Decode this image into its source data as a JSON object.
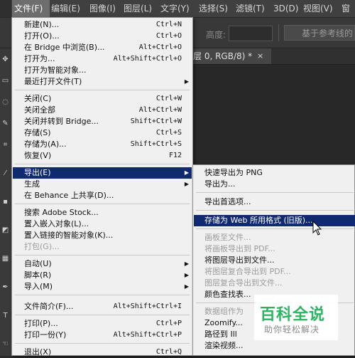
{
  "menubar": [
    "文件(F)",
    "编辑(E)",
    "图像(I)",
    "图层(L)",
    "文字(Y)",
    "选择(S)",
    "滤镜(T)",
    "3D(D)",
    "视图(V)",
    "窗"
  ],
  "options_bar": {
    "height_label": "高度:",
    "align_button": "基于参考线的"
  },
  "document_tab": {
    "title": "层 0, RGB/8) *",
    "close": "×"
  },
  "file_menu": [
    {
      "label": "新建(N)...",
      "shortcut": "Ctrl+N"
    },
    {
      "label": "打开(O)...",
      "shortcut": "Ctrl+O"
    },
    {
      "label": "在 Bridge 中浏览(B)...",
      "shortcut": "Alt+Ctrl+O"
    },
    {
      "label": "打开为...",
      "shortcut": "Alt+Shift+Ctrl+O"
    },
    {
      "label": "打开为智能对象...",
      "shortcut": ""
    },
    {
      "label": "最近打开文件(T)",
      "shortcut": ""
    },
    {
      "label": "关闭(C)",
      "shortcut": "Ctrl+W"
    },
    {
      "label": "关闭全部",
      "shortcut": "Alt+Ctrl+W"
    },
    {
      "label": "关闭并转到 Bridge...",
      "shortcut": "Shift+Ctrl+W"
    },
    {
      "label": "存储(S)",
      "shortcut": "Ctrl+S"
    },
    {
      "label": "存储为(A)...",
      "shortcut": "Shift+Ctrl+S"
    },
    {
      "label": "恢复(V)",
      "shortcut": "F12"
    },
    {
      "label": "导出(E)",
      "shortcut": ""
    },
    {
      "label": "生成",
      "shortcut": ""
    },
    {
      "label": "在 Behance 上共享(D)...",
      "shortcut": ""
    },
    {
      "label": "搜索 Adobe Stock...",
      "shortcut": ""
    },
    {
      "label": "置入嵌入对象(L)...",
      "shortcut": ""
    },
    {
      "label": "置入链接的智能对象(K)...",
      "shortcut": ""
    },
    {
      "label": "打包(G)...",
      "shortcut": ""
    },
    {
      "label": "自动(U)",
      "shortcut": ""
    },
    {
      "label": "脚本(R)",
      "shortcut": ""
    },
    {
      "label": "导入(M)",
      "shortcut": ""
    },
    {
      "label": "文件简介(F)...",
      "shortcut": "Alt+Shift+Ctrl+I"
    },
    {
      "label": "打印(P)...",
      "shortcut": "Ctrl+P"
    },
    {
      "label": "打印一份(Y)",
      "shortcut": "Alt+Shift+Ctrl+P"
    },
    {
      "label": "退出(X)",
      "shortcut": "Ctrl+Q"
    }
  ],
  "export_submenu": [
    {
      "label": "快速导出为 PNG"
    },
    {
      "label": "导出为..."
    },
    {
      "label": "导出首选项..."
    },
    {
      "label": "存储为 Web 所用格式 (旧版)..."
    },
    {
      "label": "画板至文件..."
    },
    {
      "label": "将画板导出到 PDF..."
    },
    {
      "label": "将图层导出到文件..."
    },
    {
      "label": "将图层复合导出到 PDF..."
    },
    {
      "label": "图层复合导出到文件..."
    },
    {
      "label": "颜色查找表..."
    },
    {
      "label": "数据组作为"
    },
    {
      "label": "Zoomify..."
    },
    {
      "label": "路径到 Ill"
    },
    {
      "label": "渲染视频..."
    }
  ],
  "watermark": {
    "title": "百科全说",
    "subtitle": "助你轻松解决"
  }
}
